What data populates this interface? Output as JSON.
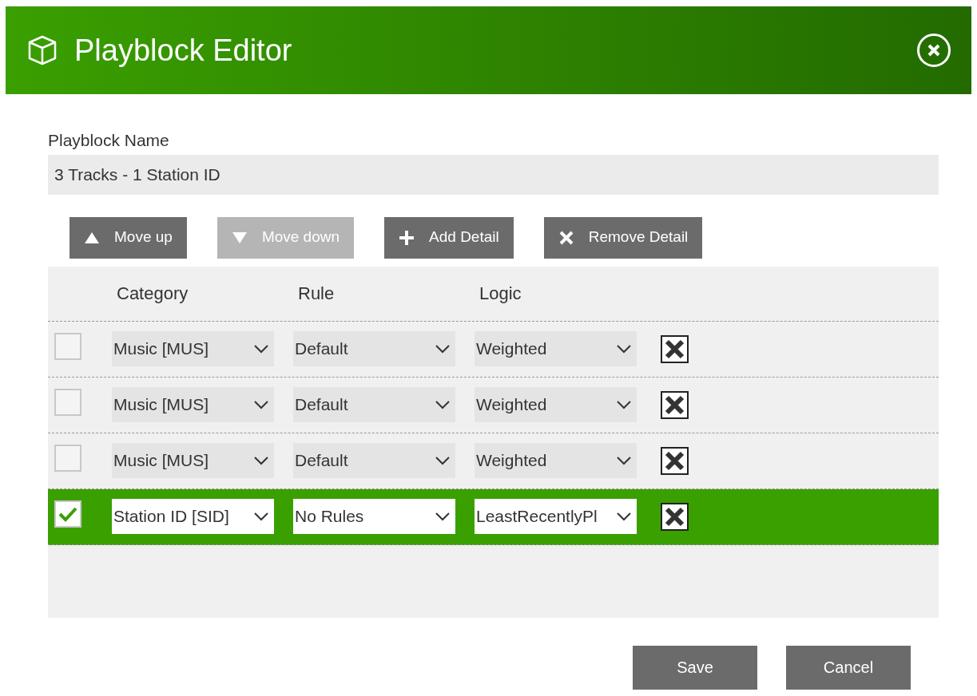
{
  "window": {
    "title": "Playblock Editor"
  },
  "name_field": {
    "label": "Playblock Name",
    "value": "3 Tracks - 1 Station ID"
  },
  "toolbar": [
    {
      "label": "Move up",
      "disabled": false
    },
    {
      "label": "Move down",
      "disabled": true
    },
    {
      "label": "Add Detail",
      "disabled": false
    },
    {
      "label": "Remove Detail",
      "disabled": false
    }
  ],
  "table": {
    "columns": [
      "Category",
      "Rule",
      "Logic"
    ],
    "rows": [
      {
        "selected": false,
        "checked": false,
        "category": "Music [MUS]",
        "rule": "Default",
        "logic": "Weighted"
      },
      {
        "selected": false,
        "checked": false,
        "category": "Music [MUS]",
        "rule": "Default",
        "logic": "Weighted"
      },
      {
        "selected": false,
        "checked": false,
        "category": "Music [MUS]",
        "rule": "Default",
        "logic": "Weighted"
      },
      {
        "selected": true,
        "checked": true,
        "category": "Station ID [SID]",
        "rule": "No Rules",
        "logic": "LeastRecentlyPl"
      }
    ]
  },
  "buttons": [
    "Save",
    "Cancel"
  ]
}
